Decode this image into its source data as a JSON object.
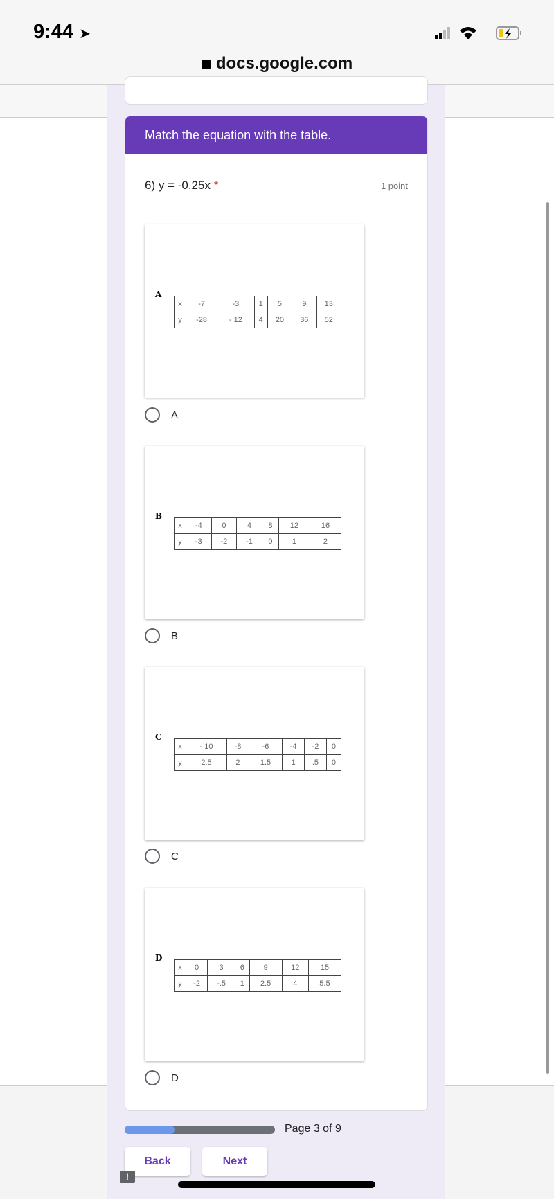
{
  "status_bar": {
    "time": "9:44",
    "location_icon": "location-arrow-icon",
    "signal_icon": "cellular-signal-icon",
    "wifi_icon": "wifi-icon",
    "battery_icon": "battery-charging-icon"
  },
  "browser": {
    "url": "docs.google.com",
    "lock_icon": "lock-icon"
  },
  "form": {
    "section_header": "Match the equation with the table.",
    "accent_color": "#673ab7",
    "question": {
      "title": "6) y = -0.25x",
      "required_mark": "*",
      "points": "1 point"
    },
    "options": [
      {
        "image_label": "A",
        "x": [
          "x",
          "-7",
          "-3",
          "1",
          "5",
          "9",
          "13"
        ],
        "y": [
          "y",
          "-28",
          "- 12",
          "4",
          "20",
          "36",
          "52"
        ],
        "label": "A"
      },
      {
        "image_label": "B",
        "x": [
          "x",
          "-4",
          "0",
          "4",
          "8",
          "12",
          "16"
        ],
        "y": [
          "y",
          "-3",
          "-2",
          "-1",
          "0",
          "1",
          "2"
        ],
        "label": "B"
      },
      {
        "image_label": "C",
        "x": [
          "x",
          "- 10",
          "-8",
          "-6",
          "-4",
          "-2",
          "0"
        ],
        "y": [
          "y",
          "2.5",
          "2",
          "1.5",
          "1",
          ".5",
          "0"
        ],
        "label": "C"
      },
      {
        "image_label": "D",
        "x": [
          "x",
          "0",
          "3",
          "6",
          "9",
          "12",
          "15"
        ],
        "y": [
          "y",
          "-2",
          "-.5",
          "1",
          "2.5",
          "4",
          "5.5"
        ],
        "label": "D"
      }
    ],
    "progress": {
      "current_page": 3,
      "total_pages": 9,
      "fraction": 0.333,
      "text": "Page 3 of 9"
    },
    "back_label": "Back",
    "next_label": "Next"
  }
}
